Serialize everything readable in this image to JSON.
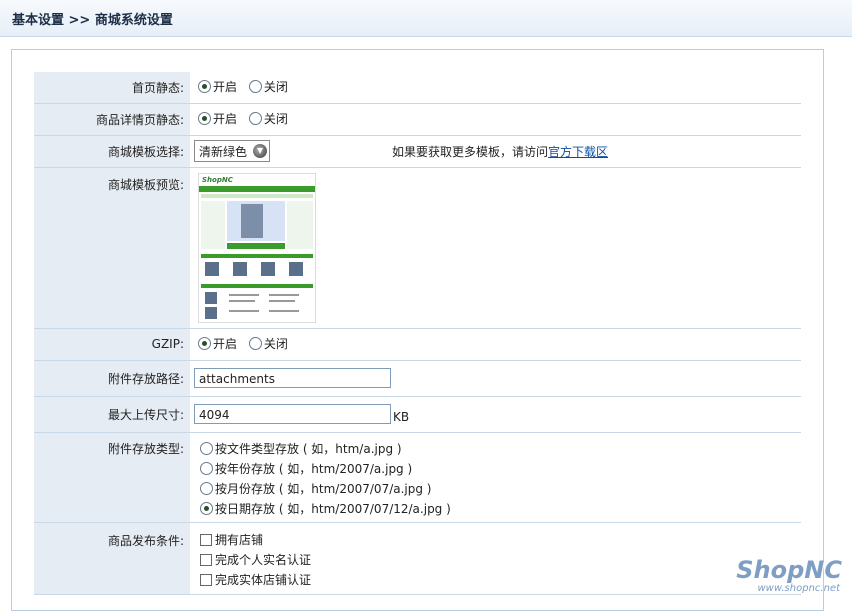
{
  "header": {
    "breadcrumb": "基本设置 >> 商城系统设置"
  },
  "rows": {
    "homepage_static": {
      "label": "首页静态:",
      "on": "开启",
      "off": "关闭"
    },
    "detail_static": {
      "label": "商品详情页静态:",
      "on": "开启",
      "off": "关闭"
    },
    "template_select": {
      "label": "商城模板选择:",
      "value": "清新绿色",
      "hint": "如果要获取更多模板，请访问",
      "link": "官方下载区"
    },
    "template_preview": {
      "label": "商城模板预览:"
    },
    "gzip": {
      "label": "GZIP:",
      "on": "开启",
      "off": "关闭"
    },
    "attach_path": {
      "label": "附件存放路径:",
      "value": "attachments"
    },
    "max_upload": {
      "label": "最大上传尺寸:",
      "value": "4094",
      "unit": "KB"
    },
    "attach_type": {
      "label": "附件存放类型:",
      "options": [
        "按文件类型存放 ( 如，htm/a.jpg )",
        "按年份存放 ( 如，htm/2007/a.jpg )",
        "按月份存放 ( 如，htm/2007/07/a.jpg )",
        "按日期存放 ( 如，htm/2007/07/12/a.jpg )"
      ],
      "selected_index": 3
    },
    "publish_condition": {
      "label": "商品发布条件:",
      "options": [
        "拥有店铺",
        "完成个人实名认证",
        "完成实体店铺认证"
      ]
    }
  },
  "watermark": {
    "logo": "ShopNC",
    "url": "www.shopnc.net"
  },
  "colors": {
    "label_bg": "#e6ecf3",
    "border": "#c9d8e6",
    "link": "#0b4fa3",
    "preview_green": "#3a9a2a"
  }
}
